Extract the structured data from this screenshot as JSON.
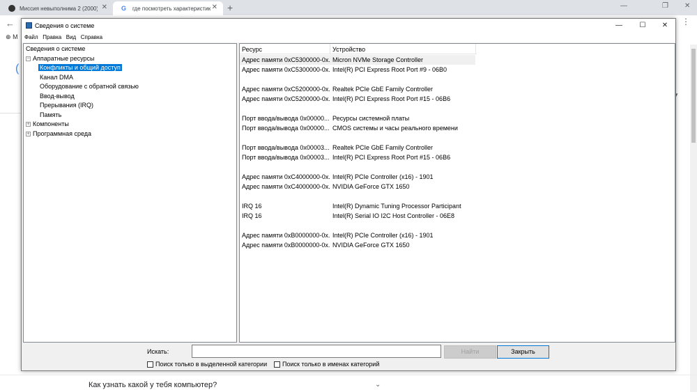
{
  "browser": {
    "tabs": [
      {
        "title": "Миссия невыполнима 2 (2000) с..."
      },
      {
        "title": "где посмотреть характеристики..."
      }
    ],
    "new_tab": "+",
    "window_controls": {
      "minimize": "—",
      "maximize": "❐",
      "close": "✕"
    },
    "bookmark_initial": "М",
    "bottom_question": "Как узнать какой у тебя компьютер?"
  },
  "window": {
    "title": "Сведения о системе",
    "controls": {
      "minimize": "—",
      "maximize": "☐",
      "close": "✕"
    },
    "menu": [
      "Файл",
      "Правка",
      "Вид",
      "Справка"
    ]
  },
  "tree": {
    "root": "Сведения о системе",
    "hardware": "Аппаратные ресурсы",
    "hardware_children": [
      "Конфликты и общий доступ",
      "Канал DMA",
      "Оборудование с обратной связью",
      "Ввод-вывод",
      "Прерывания (IRQ)",
      "Память"
    ],
    "components": "Компоненты",
    "software": "Программная среда",
    "selected": "Конфликты и общий доступ"
  },
  "list": {
    "columns": [
      "Ресурс",
      "Устройство"
    ],
    "rows": [
      {
        "resource": "Адрес памяти 0xC5300000-0x...",
        "device": "Micron NVMe Storage Controller"
      },
      {
        "resource": "Адрес памяти 0xC5300000-0x...",
        "device": "Intel(R) PCI Express Root Port #9 - 06B0"
      },
      {
        "resource": "Адрес памяти 0xC5200000-0x...",
        "device": "Realtek PCIe GbE Family Controller"
      },
      {
        "resource": "Адрес памяти 0xC5200000-0x...",
        "device": "Intel(R) PCI Express Root Port #15 - 06B6"
      },
      {
        "resource": "Порт ввода/вывода 0x00000...",
        "device": "Ресурсы системной платы"
      },
      {
        "resource": "Порт ввода/вывода 0x00000...",
        "device": "CMOS системы и часы реального времени"
      },
      {
        "resource": "Порт ввода/вывода 0x00003...",
        "device": "Realtek PCIe GbE Family Controller"
      },
      {
        "resource": "Порт ввода/вывода 0x00003...",
        "device": "Intel(R) PCI Express Root Port #15 - 06B6"
      },
      {
        "resource": "Адрес памяти 0xC4000000-0x...",
        "device": "Intel(R) PCIe Controller (x16) - 1901"
      },
      {
        "resource": "Адрес памяти 0xC4000000-0x...",
        "device": "NVIDIA GeForce GTX 1650"
      },
      {
        "resource": "IRQ 16",
        "device": "Intel(R) Dynamic Tuning Processor Participant"
      },
      {
        "resource": "IRQ 16",
        "device": "Intel(R) Serial IO I2C Host Controller - 06E8"
      },
      {
        "resource": "Адрес памяти 0xB0000000-0x...",
        "device": "Intel(R) PCIe Controller (x16) - 1901"
      },
      {
        "resource": "Адрес памяти 0xB0000000-0x...",
        "device": "NVIDIA GeForce GTX 1650"
      }
    ]
  },
  "search": {
    "label": "Искать:",
    "value": "",
    "find_button": "Найти",
    "close_button": "Закрыть",
    "check_selected": "Поиск только в выделенной категории",
    "check_names": "Поиск только в именах категорий"
  }
}
